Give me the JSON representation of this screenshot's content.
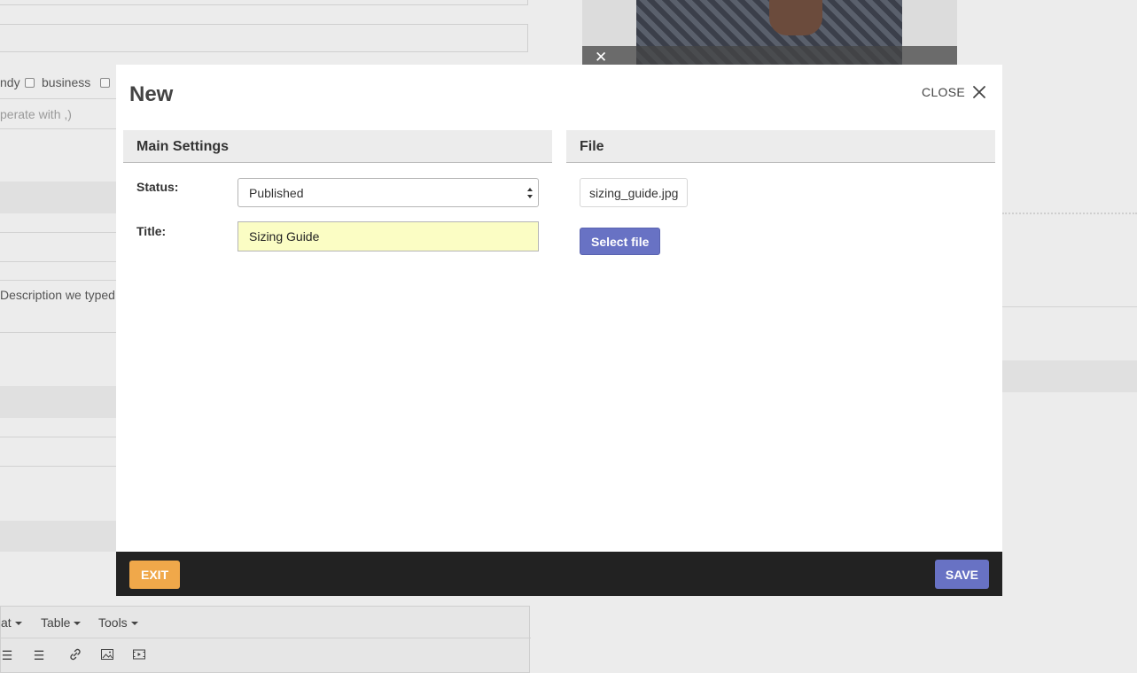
{
  "background": {
    "tags": [
      "ndy",
      "business"
    ],
    "separator_hint": "perate with ,)",
    "description_preview": "Description we typed i",
    "editor_menu": [
      "at",
      "Table",
      "Tools"
    ],
    "photo_close_icon": "close-icon"
  },
  "modal": {
    "title": "New",
    "close_label": "CLOSE",
    "main_settings": {
      "heading": "Main Settings",
      "status_label": "Status:",
      "status_value": "Published",
      "title_label": "Title:",
      "title_value": "Sizing Guide"
    },
    "file_panel": {
      "heading": "File",
      "file_name": "sizing_guide.jpg",
      "select_button": "Select file"
    },
    "footer": {
      "exit_label": "EXIT",
      "save_label": "SAVE"
    }
  },
  "colors": {
    "primary": "#6872c4",
    "exit": "#f0a84a",
    "footer_bg": "#222222",
    "highlight_input": "#fbfdc4"
  }
}
